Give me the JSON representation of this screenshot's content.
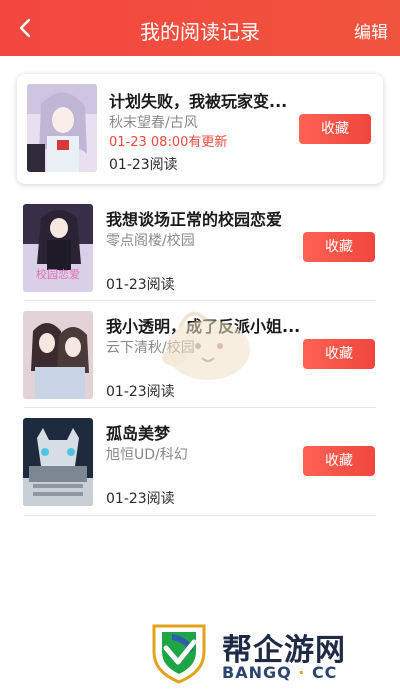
{
  "header": {
    "title": "我的阅读记录",
    "edit_label": "编辑"
  },
  "books": [
    {
      "title": "计划失败，我被玩家变...",
      "author_genre": "秋末望春/古风",
      "update": "01-23 08:00有更新",
      "read": "01-23阅读",
      "fav_label": "收藏"
    },
    {
      "title": "我想谈场正常的校园恋爱",
      "author_genre": "零点阁楼/校园",
      "read": "01-23阅读",
      "fav_label": "收藏"
    },
    {
      "title": "我小透明，成了反派小姐...",
      "author_genre": "云下清秋/校园",
      "read": "01-23阅读",
      "fav_label": "收藏"
    },
    {
      "title": "孤岛美梦",
      "author_genre": "旭恒UD/科幻",
      "read": "01-23阅读",
      "fav_label": "收藏"
    }
  ],
  "watermark": {
    "brand": "帮企游网",
    "domain_a": "BANGQ",
    "dot": "·",
    "domain_b": "CC"
  },
  "colors": {
    "accent": "#f2463f",
    "update_text": "#ef4a3d"
  }
}
